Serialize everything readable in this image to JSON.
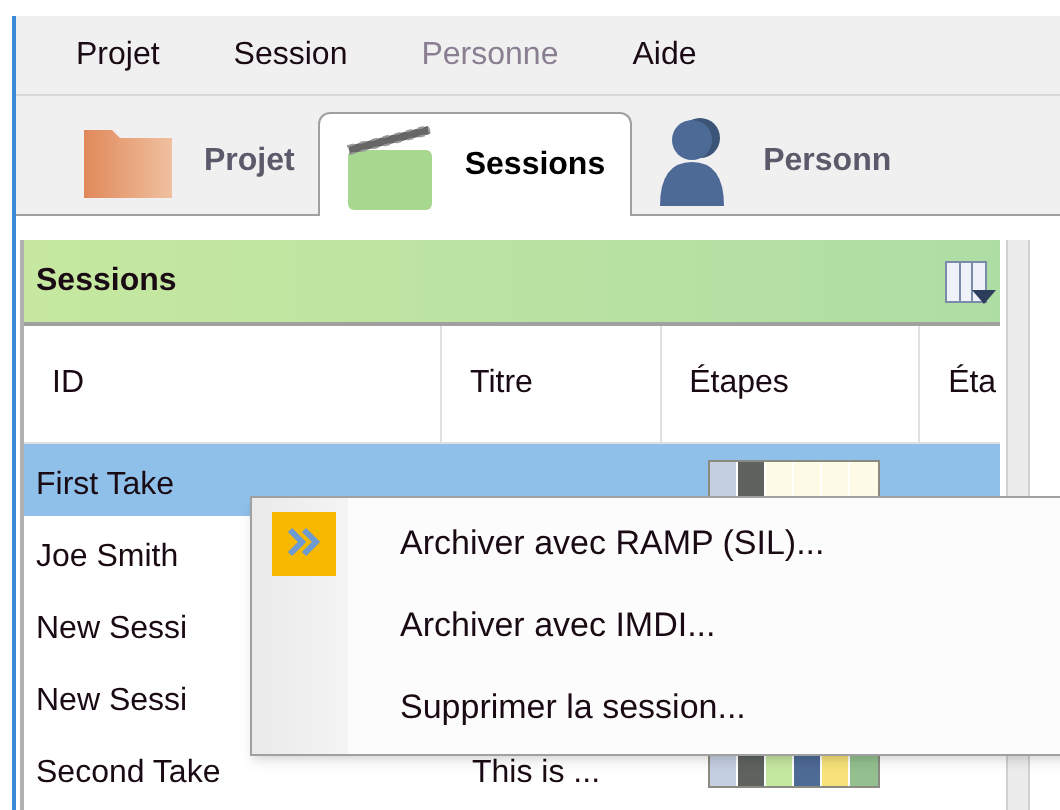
{
  "menu_bar": [
    {
      "label": "Projet",
      "disabled": false
    },
    {
      "label": "Session",
      "disabled": false
    },
    {
      "label": "Personne",
      "disabled": true
    },
    {
      "label": "Aide",
      "disabled": false
    }
  ],
  "tabs": [
    {
      "label": "Projet",
      "kind": "folder",
      "selected": false
    },
    {
      "label": "Sessions",
      "kind": "clapper",
      "selected": true
    },
    {
      "label": "Personn",
      "kind": "person",
      "selected": false
    }
  ],
  "panel": {
    "title": "Sessions"
  },
  "table": {
    "columns": [
      "ID",
      "Titre",
      "Étapes",
      "Éta"
    ],
    "rows": [
      {
        "id": "First Take",
        "title": "",
        "selected": true,
        "stages": [
          {
            "color": "#c4cfe0"
          },
          {
            "color": "#5f6360"
          },
          {
            "color": "#fdfbe6"
          },
          {
            "color": "#fdfbe6"
          },
          {
            "color": "#fdfbe6"
          },
          {
            "color": "#fdfbe6"
          }
        ]
      },
      {
        "id": "Joe Smith",
        "title": "",
        "selected": false,
        "stages": []
      },
      {
        "id": "New Sessi",
        "title": "",
        "selected": false,
        "stages": []
      },
      {
        "id": "New Sessi",
        "title": "",
        "selected": false,
        "stages": []
      },
      {
        "id": "Second Take",
        "title": "This is ...",
        "selected": false,
        "stages": [
          {
            "color": "#c4cfe0"
          },
          {
            "color": "#5f6360"
          },
          {
            "color": "#c5e8a0"
          },
          {
            "color": "#4e6b96"
          },
          {
            "color": "#f7e27a"
          },
          {
            "color": "#93c08e"
          }
        ]
      }
    ]
  },
  "context_menu": [
    {
      "label": "Archiver avec RAMP (SIL)...",
      "kind": "ramp"
    },
    {
      "label": "Archiver avec IMDI...",
      "kind": "plain"
    },
    {
      "label": "Supprimer la session...",
      "kind": "plain"
    }
  ]
}
